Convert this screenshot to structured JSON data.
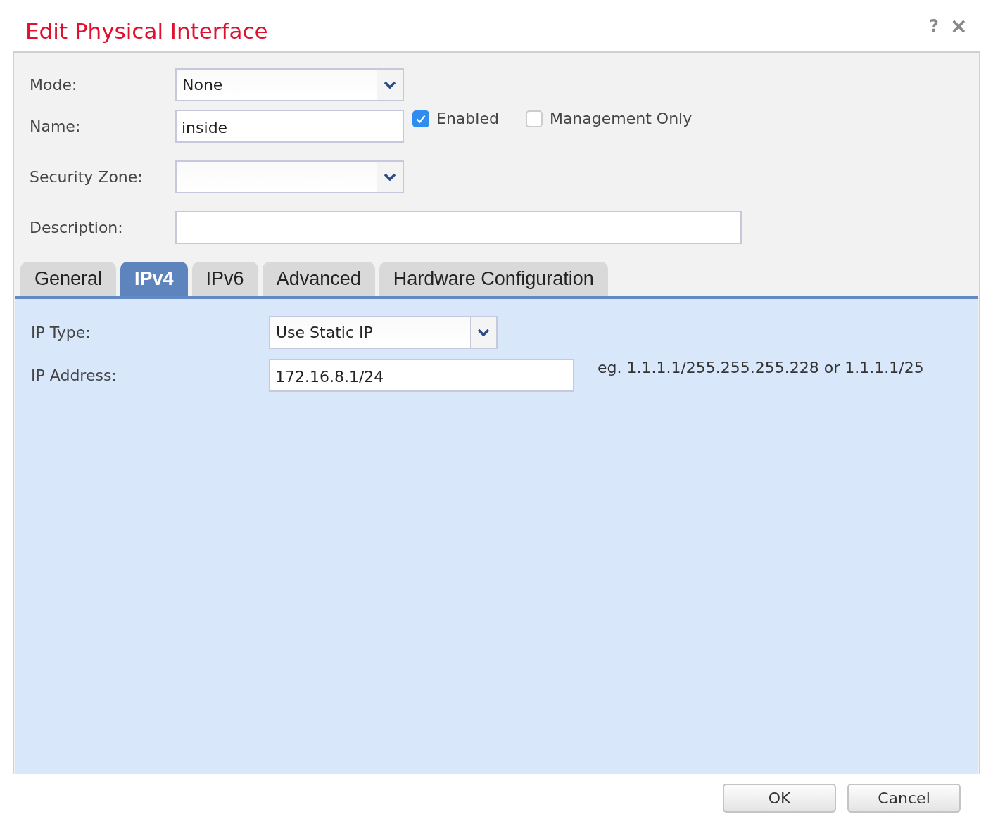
{
  "window": {
    "title": "Edit Physical Interface",
    "help": "?",
    "close": "×"
  },
  "form": [
    {
      "kind": "select",
      "label": "Mode:",
      "value": "None"
    },
    {
      "kind": "text",
      "label": "Name:",
      "value": "inside",
      "checkboxes": [
        {
          "label": "Enabled",
          "checked": true
        },
        {
          "label": "Management Only",
          "checked": false
        }
      ]
    },
    {
      "kind": "select",
      "label": "Security Zone:"
    },
    {
      "kind": "wide",
      "label": "Description:"
    }
  ],
  "tabs": [
    {
      "label": "General",
      "selected": false
    },
    {
      "label": "IPv4",
      "selected": true
    },
    {
      "label": "IPv6",
      "selected": false
    },
    {
      "label": "Advanced",
      "selected": false
    },
    {
      "label": "Hardware Configuration",
      "selected": false
    }
  ],
  "ipv4": [
    {
      "kind": "select",
      "label": "IP Type:",
      "value": "Use Static IP"
    },
    {
      "kind": "text",
      "label": "IP Address:",
      "value": "172.16.8.1/24",
      "hint": "eg. 1.1.1.1/255.255.255.228 or 1.1.1.1/25"
    }
  ],
  "buttons": [
    "OK",
    "Cancel"
  ]
}
